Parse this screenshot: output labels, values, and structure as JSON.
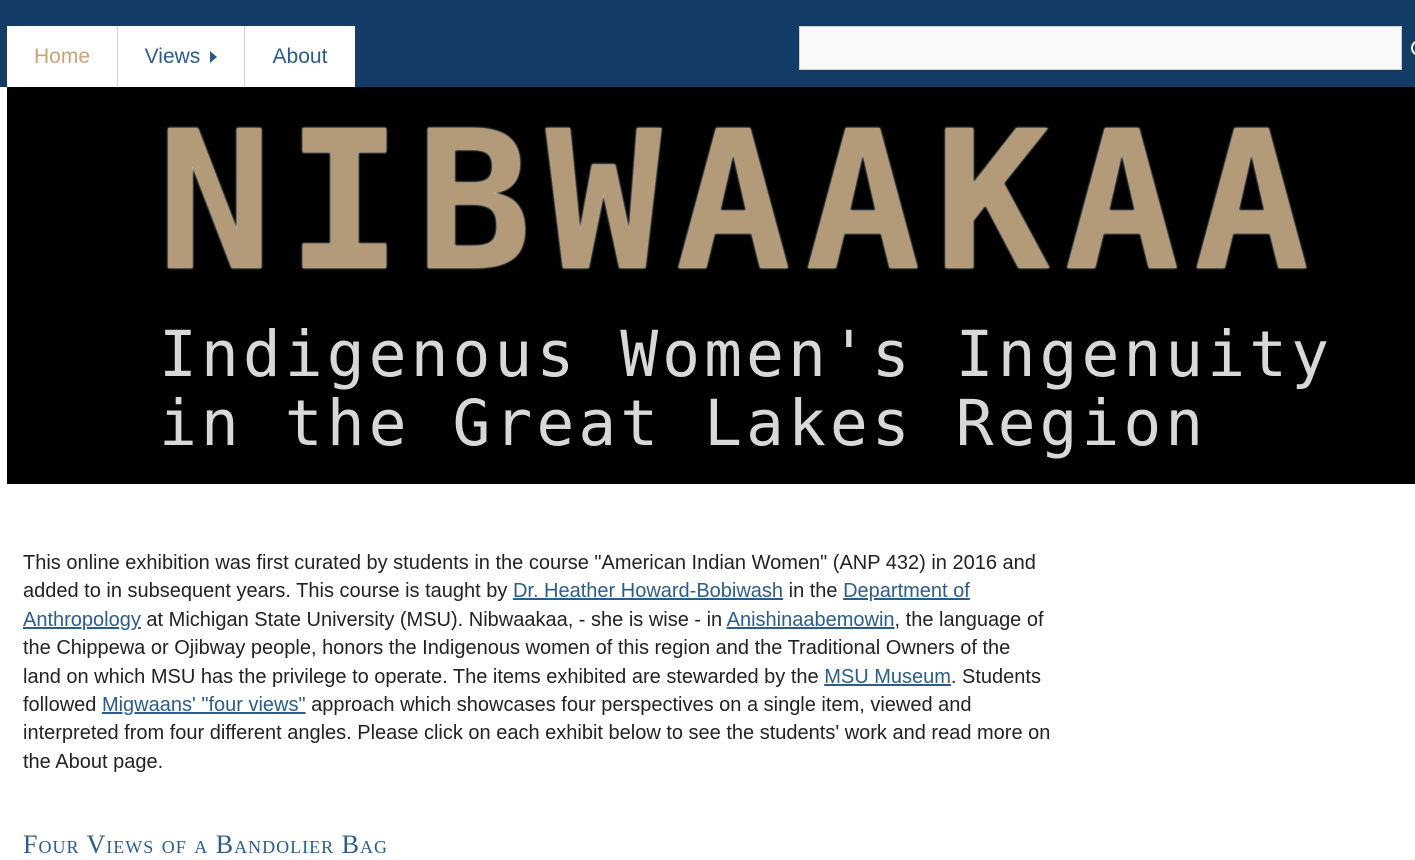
{
  "nav": {
    "home": "Home",
    "views": "Views",
    "about": "About"
  },
  "search": {
    "value": "",
    "placeholder": ""
  },
  "banner": {
    "title": "NIBWAAKAA",
    "subtitle_line1": "Indigenous Women's Ingenuity",
    "subtitle_line2": "in the Great Lakes Region"
  },
  "intro": {
    "t1": "This online exhibition was first curated by students in the course \"American Indian Women\" (ANP 432) in 2016 and added to in subsequent years. This course is taught by ",
    "link1": "Dr. Heather Howard-Bobiwash",
    "t2": " in the ",
    "link2": "Department of Anthropology",
    "t3": " at Michigan State University (MSU).  Nibwaakaa, - she is wise - in ",
    "link3": "Anishinaabemowin",
    "t4": ", the language of the Chippewa or Ojibway people, honors the Indigenous women of this region and the Traditional Owners of the land on which MSU has the privilege to operate. The items exhibited are stewarded by the ",
    "link4": "MSU Museum",
    "t5": ". Students followed ",
    "link5": "Migwaans' \"four views\"",
    "t6": " approach which showcases four perspectives on a single item, viewed and interpreted from four different angles. Please click on each exhibit below to see the students' work and read more on the About page."
  },
  "exhibit": {
    "title": "Four Views of a Bandolier Bag"
  },
  "colors": {
    "header_bg": "#133d66",
    "link": "#2b5d8c",
    "home_active": "#c9a276"
  }
}
